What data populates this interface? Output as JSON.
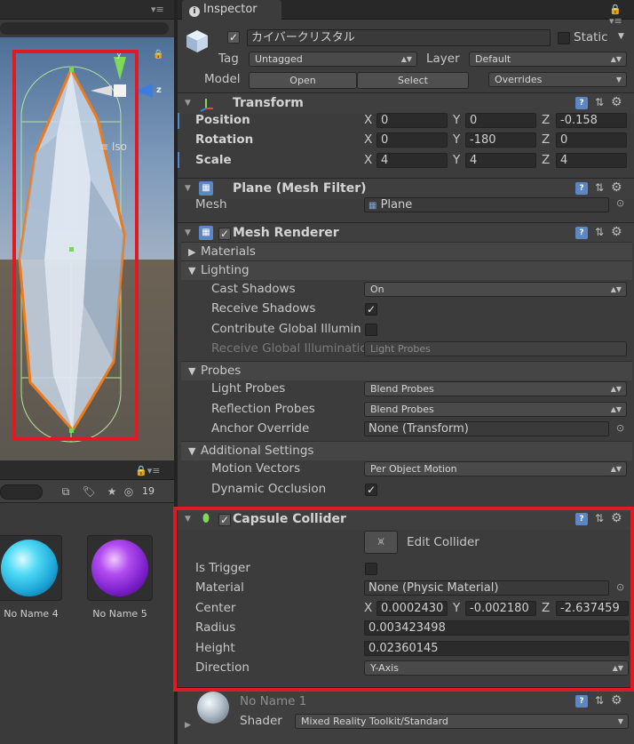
{
  "scene": {
    "menu_glyph": "▾≡",
    "lock_glyph": "🔒",
    "axis_y": "y",
    "axis_z": "z",
    "iso_label": "≡ Iso"
  },
  "project": {
    "menu_glyph": "🔒▾≡",
    "hidden_count": "19",
    "assets": [
      {
        "label": "No Name 4",
        "color": "#26c4ee"
      },
      {
        "label": "No Name 5",
        "color": "#8a2be2"
      }
    ]
  },
  "inspector": {
    "tab_label": "Inspector",
    "tab_icon": "i",
    "tab_menu_glyph": "🔒 ▾≡",
    "object": {
      "name": "カイバークリスタル",
      "active_check": "✓",
      "static_label": "Static",
      "tag_label": "Tag",
      "tag_value": "Untagged",
      "layer_label": "Layer",
      "layer_value": "Default",
      "model_label": "Model",
      "open_button": "Open",
      "select_button": "Select",
      "overrides_value": "Overrides"
    },
    "transform": {
      "title": "Transform",
      "rows": [
        {
          "label": "Position",
          "x": "0",
          "y": "0",
          "z": "-0.158"
        },
        {
          "label": "Rotation",
          "x": "0",
          "y": "-180",
          "z": "0"
        },
        {
          "label": "Scale",
          "x": "4",
          "y": "4",
          "z": "4"
        }
      ]
    },
    "mesh_filter": {
      "title": "Plane (Mesh Filter)",
      "mesh_label": "Mesh",
      "mesh_value": "Plane"
    },
    "mesh_renderer": {
      "title": "Mesh Renderer",
      "materials_label": "Materials",
      "lighting_label": "Lighting",
      "cast_shadows_label": "Cast Shadows",
      "cast_shadows_value": "On",
      "receive_shadows_label": "Receive Shadows",
      "contribute_gi_label": "Contribute Global Illumin",
      "receive_gi_label": "Receive Global Illuminatic",
      "receive_gi_value": "Light Probes",
      "probes_label": "Probes",
      "light_probes_label": "Light Probes",
      "light_probes_value": "Blend Probes",
      "reflection_probes_label": "Reflection Probes",
      "reflection_probes_value": "Blend Probes",
      "anchor_override_label": "Anchor Override",
      "anchor_override_value": "None (Transform)",
      "additional_settings_label": "Additional Settings",
      "motion_vectors_label": "Motion Vectors",
      "motion_vectors_value": "Per Object Motion",
      "dynamic_occlusion_label": "Dynamic Occlusion"
    },
    "capsule_collider": {
      "title": "Capsule Collider",
      "edit_collider_label": "Edit Collider",
      "is_trigger_label": "Is Trigger",
      "material_label": "Material",
      "material_value": "None (Physic Material)",
      "center_label": "Center",
      "center_x": "0.0002430",
      "center_y": "-0.002180",
      "center_z": "-2.637459",
      "radius_label": "Radius",
      "radius_value": "0.003423498",
      "height_label": "Height",
      "height_value": "0.02360145",
      "direction_label": "Direction",
      "direction_value": "Y-Axis"
    },
    "material": {
      "name": "No Name 1",
      "shader_label": "Shader",
      "shader_value": "Mixed Reality Toolkit/Standard"
    },
    "axis": {
      "x": "X",
      "y": "Y",
      "z": "Z"
    }
  },
  "colors": {
    "highlight_box": "#e01a22",
    "selection_outline": "#f07a1a",
    "panel_bg": "#3c3c3c"
  }
}
